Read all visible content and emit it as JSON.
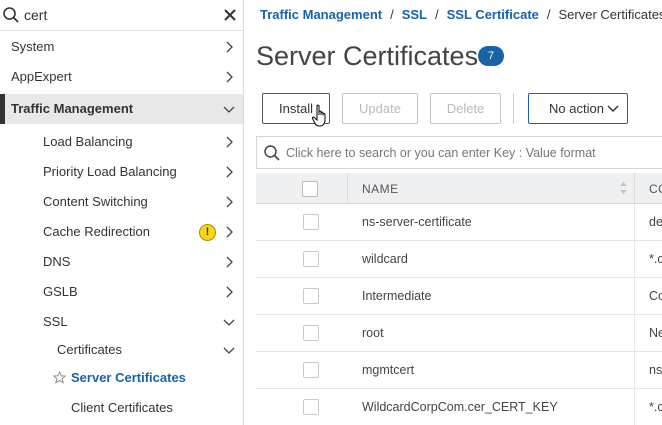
{
  "sidebar": {
    "search": {
      "value": "cert"
    },
    "items": [
      {
        "label": "System",
        "level": 0,
        "icon": "chevron-right-icon"
      },
      {
        "label": "AppExpert",
        "level": 0,
        "icon": "chevron-right-icon"
      },
      {
        "label": "Traffic Management",
        "level": 0,
        "icon": "chevron-down-icon",
        "expanded": true
      },
      {
        "label": "Load Balancing",
        "level": 1,
        "icon": "chevron-right-icon"
      },
      {
        "label": "Priority Load Balancing",
        "level": 1,
        "icon": "chevron-right-icon"
      },
      {
        "label": "Content Switching",
        "level": 1,
        "icon": "chevron-right-icon"
      },
      {
        "label": "Cache Redirection",
        "level": 1,
        "icon": "chevron-right-icon",
        "badge": "!"
      },
      {
        "label": "DNS",
        "level": 1,
        "icon": "chevron-right-icon"
      },
      {
        "label": "GSLB",
        "level": 1,
        "icon": "chevron-right-icon"
      },
      {
        "label": "SSL",
        "level": 1,
        "icon": "chevron-down-icon",
        "expanded": true
      },
      {
        "label": "Certificates",
        "level": 2,
        "icon": "chevron-down-icon",
        "expanded": true
      },
      {
        "label": "Server Certificates",
        "level": 3,
        "icon": "star-icon",
        "selected": true
      },
      {
        "label": "Client Certificates",
        "level": 3
      }
    ]
  },
  "breadcrumb": {
    "items": [
      "Traffic Management",
      "SSL",
      "SSL Certificate"
    ],
    "current": "Server Certificates",
    "separator": "/"
  },
  "page": {
    "title": "Server Certificates",
    "count": "7"
  },
  "toolbar": {
    "install_label": "Install",
    "update_label": "Update",
    "delete_label": "Delete",
    "action_label": "No action"
  },
  "table": {
    "search_placeholder": "Click here to search or you can enter Key : Value format",
    "columns": [
      "NAME",
      "CO"
    ],
    "rows": [
      {
        "name": "ns-server-certificate",
        "col2": "de"
      },
      {
        "name": "wildcard",
        "col2": "*.c"
      },
      {
        "name": "Intermediate",
        "col2": "Co"
      },
      {
        "name": "root",
        "col2": "Ne"
      },
      {
        "name": "mgmtcert",
        "col2": "ns"
      },
      {
        "name": "WildcardCorpCom.cer_CERT_KEY",
        "col2": "*.c"
      }
    ]
  },
  "colors": {
    "accent": "#1a63a8",
    "warning": "#f7d51d",
    "active_nav_bg": "#e8e8e8"
  }
}
